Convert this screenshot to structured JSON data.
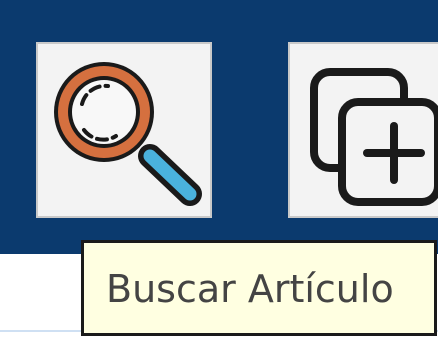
{
  "toolbar": {
    "buttons": [
      {
        "icon": "magnifier-search-icon"
      },
      {
        "icon": "add-copy-icon"
      }
    ]
  },
  "tooltip": {
    "text": "Buscar Artículo"
  },
  "colors": {
    "toolbar_bg": "#0b3a6e",
    "tooltip_bg": "#ffffe1",
    "magnifier_frame": "#d5703f",
    "magnifier_handle": "#4ab2dd"
  }
}
